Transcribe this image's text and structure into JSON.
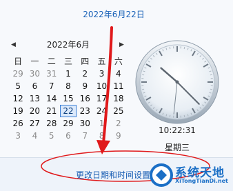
{
  "header": {
    "date": "2022年6月22日"
  },
  "calendar": {
    "prev_icon": "◀",
    "next_icon": "▶",
    "month_label": "2022年6月",
    "weekdays": [
      "日",
      "一",
      "二",
      "三",
      "四",
      "五",
      "六"
    ],
    "weeks": [
      [
        "29",
        "30",
        "31",
        "1",
        "2",
        "3",
        "4"
      ],
      [
        "5",
        "6",
        "7",
        "8",
        "9",
        "10",
        "11"
      ],
      [
        "12",
        "13",
        "14",
        "15",
        "16",
        "17",
        "18"
      ],
      [
        "19",
        "20",
        "21",
        "22",
        "23",
        "24",
        "25"
      ],
      [
        "26",
        "27",
        "28",
        "29",
        "30",
        "1",
        "2"
      ],
      [
        "3",
        "4",
        "5",
        "6",
        "7",
        "8",
        "9"
      ]
    ],
    "selected_day": "22"
  },
  "clock": {
    "time": "10:22:31",
    "weekday": "星期三",
    "hour": 10,
    "minute": 22,
    "second": 31
  },
  "footer": {
    "link": "更改日期和时间设置..."
  },
  "watermark": {
    "name": "系统天地",
    "url": "XiTongTianDi.net"
  },
  "colors": {
    "link": "#1a5fb4",
    "annotation": "#e0191b",
    "selection": "#3a7fd5"
  }
}
